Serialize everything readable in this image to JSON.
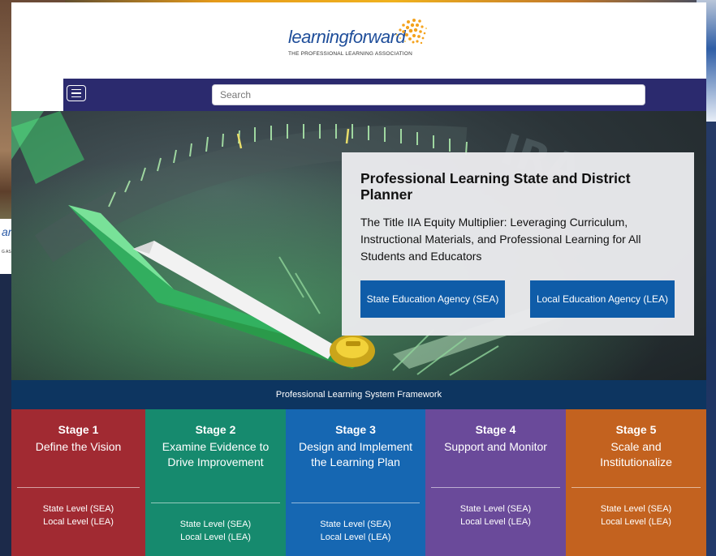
{
  "brand": {
    "logo_text_1": "learning",
    "logo_text_2": "forward",
    "tagline": "THE PROFESSIONAL LEARNING ASSOCIATION"
  },
  "background_card": {
    "logo_fragment": "ard",
    "tagline_fragment": "G ASSOCIATION"
  },
  "search": {
    "placeholder": "Search"
  },
  "hero": {
    "title": "Professional Learning State and District Planner",
    "subtitle": "The Title IIA Equity Multiplier: Leveraging Curriculum, Instructional Materials, and Professional Learning for All Students and Educators",
    "sea_button": "State Education Agency (SEA)",
    "lea_button": "Local Education Agency (LEA)"
  },
  "framework": {
    "label": "Professional Learning System Framework"
  },
  "stages": [
    {
      "number": "Stage 1",
      "name": "Define the Vision",
      "sea": "State Level (SEA)",
      "lea": "Local Level (LEA)",
      "color": "#a12a32"
    },
    {
      "number": "Stage 2",
      "name": "Examine Evidence to Drive Improvement",
      "sea": "State Level (SEA)",
      "lea": "Local Level (LEA)",
      "color": "#168a6e"
    },
    {
      "number": "Stage 3",
      "name": "Design and Implement the Learning Plan",
      "sea": "State Level (SEA)",
      "lea": "Local Level (LEA)",
      "color": "#1667b2"
    },
    {
      "number": "Stage 4",
      "name": "Support and Monitor",
      "sea": "State Level (SEA)",
      "lea": "Local Level (LEA)",
      "color": "#6a4a9a"
    },
    {
      "number": "Stage 5",
      "name": "Scale and Institutionalize",
      "sea": "State Level (SEA)",
      "lea": "Local Level (LEA)",
      "color": "#c3621f"
    }
  ],
  "colors": {
    "navbar": "#2b2a6e",
    "button": "#0f5ca8",
    "framework_bar": "#0d3560"
  },
  "icons": [
    "hamburger-menu-icon",
    "logo-burst-icon"
  ]
}
